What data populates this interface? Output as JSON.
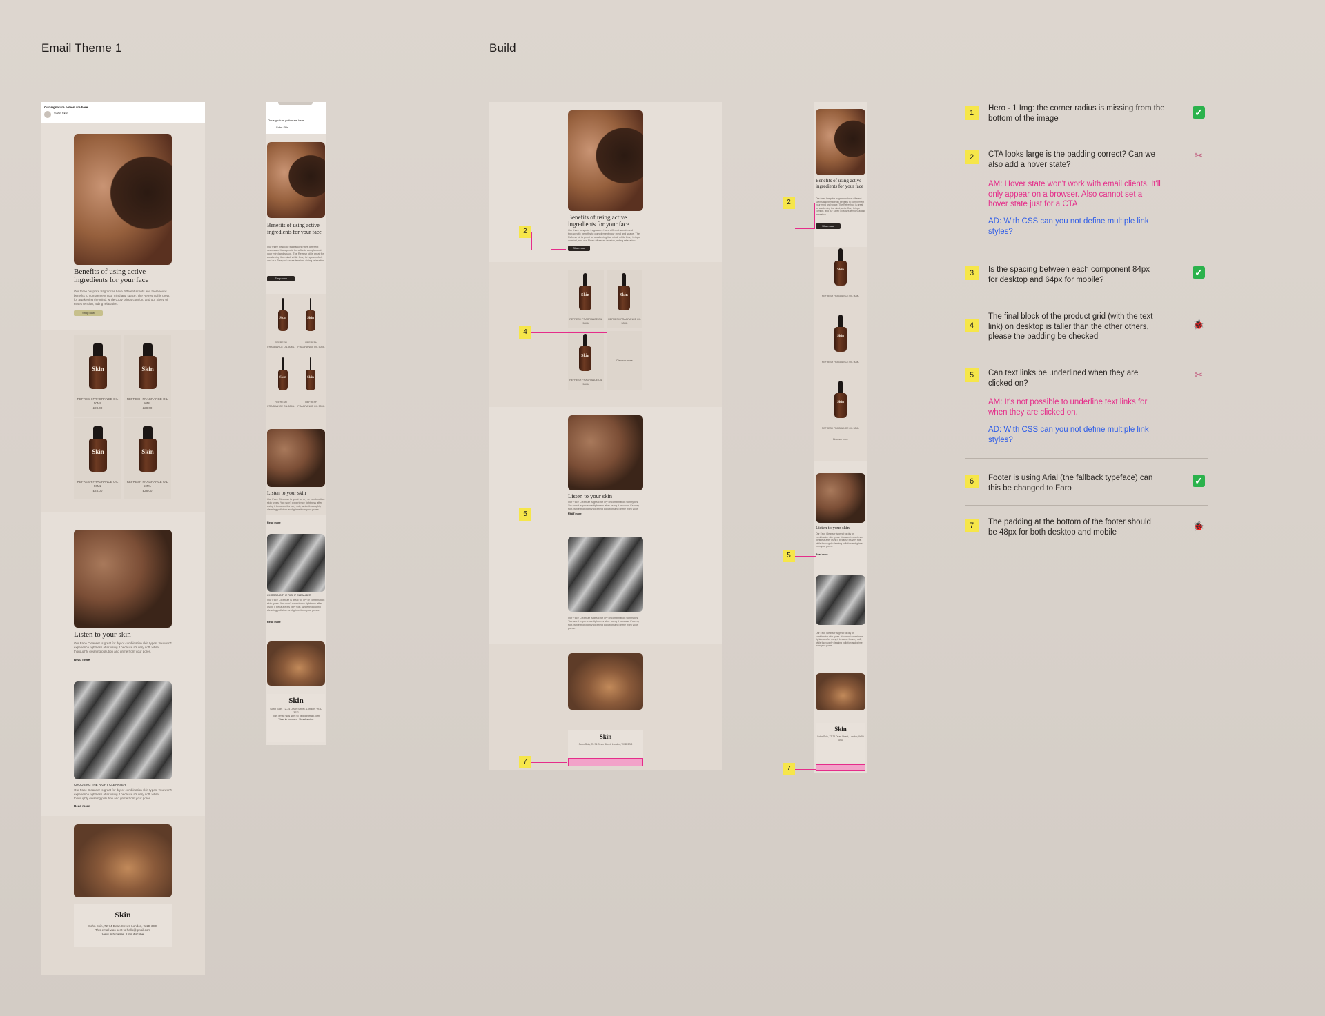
{
  "sections": {
    "left_title": "Email Theme 1",
    "right_title": "Build"
  },
  "email": {
    "subject": "Our signature potion are here",
    "sender": "Sohn Skin",
    "hero_title": "Benefits of using active ingredients for your face",
    "hero_body": "Our three bespoke fragrances have different scents and therapeutic benefits to complement your mind and space. The Refresh oil is great for awakening the mind, while Cozy brings comfort, and our Sleep oil eases tension, aiding relaxation.",
    "cta": "Shop now",
    "product_name": "REFRESH FRAGRANCE OIL 50ML",
    "product_price": "£28.00",
    "discover_link": "Discover more",
    "listen_title": "Listen to your skin",
    "listen_body": "Our Face Cleanser is great for dry or combination skin types. You won't experience tightness after using it because it's very soft, while thoroughly cleaning pollution and grime from your pores.",
    "read_more": "Read more",
    "cleanser_label": "CHOOSING THE RIGHT CLEANSER",
    "logo": "Skin",
    "footer_address": "Sohn Skin, 72-74 Dean Street, London, W1D 3SG",
    "footer_email": "This email was sent to hello@gmail.com",
    "view_browser": "View in browser",
    "unsubscribe": "Unsubscribe"
  },
  "notes": [
    {
      "num": "1",
      "text": "Hero - 1 Img: the corner radius is missing from the bottom of the image",
      "status": "check"
    },
    {
      "num": "2",
      "text": "CTA looks large is the padding correct? Can we also add a ",
      "link": "hover state?",
      "am": "AM: Hover state won't work with email clients. It'll only appear on a browser. Also cannot set a hover state just for a CTA",
      "ad": "AD: With CSS can you not define multiple link styles?",
      "status": "scissors"
    },
    {
      "num": "3",
      "text": "Is the spacing between each component 84px for desktop and 64px for mobile?",
      "status": "check"
    },
    {
      "num": "4",
      "text": "The final block of the product grid (with the text link) on desktop is taller than the other others, please the padding be checked",
      "status": "bug"
    },
    {
      "num": "5",
      "text": "Can text links be underlined when they are clicked on?",
      "am": "AM: It's not possible to underline text links for when they are clicked on.",
      "ad": "AD: With CSS can you not define multiple link styles?",
      "status": "scissors"
    },
    {
      "num": "6",
      "text": "Footer is using Arial (the fallback typeface) can this be changed to Faro",
      "status": "check"
    },
    {
      "num": "7",
      "text": "The padding at the bottom of the footer should be 48px for both desktop and mobile",
      "status": "bug"
    }
  ],
  "markers": {
    "m2": "2",
    "m4": "4",
    "m5": "5",
    "m7": "7"
  },
  "status_icons": {
    "check": "✓",
    "scissors": "✂",
    "bug": "🐞"
  },
  "colors": {
    "note_am": "#e52d8a",
    "note_ad": "#2f5de8",
    "marker": "#f6e64a",
    "check": "#2bb24c"
  }
}
